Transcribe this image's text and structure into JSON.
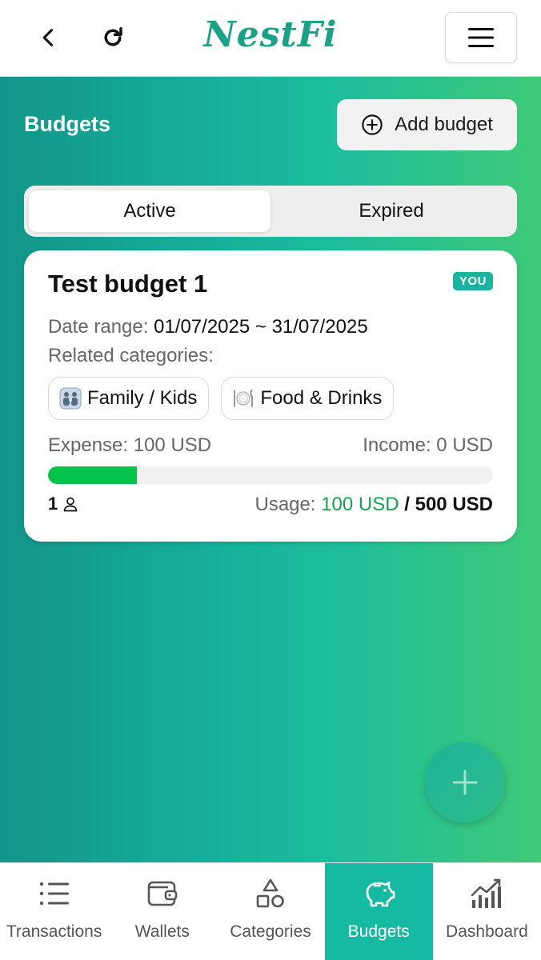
{
  "header": {
    "logo": "NestFi",
    "back_icon": "chevron-left-icon",
    "refresh_icon": "refresh-icon",
    "menu_icon": "hamburger-menu-icon"
  },
  "page": {
    "title": "Budgets",
    "add_button_label": "Add budget",
    "add_button_icon": "plus-circle-icon"
  },
  "tabs": [
    {
      "label": "Active",
      "active": true
    },
    {
      "label": "Expired",
      "active": false
    }
  ],
  "budget": {
    "title": "Test budget 1",
    "badge": "YOU",
    "date_range_label": "Date range:",
    "date_range_value": "01/07/2025 ~ 31/07/2025",
    "categories_label": "Related categories:",
    "categories": [
      {
        "label": "Family / Kids",
        "icon": "family-icon"
      },
      {
        "label": "Food & Drinks",
        "icon": "plate-cutlery-icon"
      }
    ],
    "expense_text": "Expense: 100 USD",
    "income_text": "Income: 0 USD",
    "usage_fraction": 0.2,
    "members_count": "1",
    "usage_label": "Usage:",
    "usage_used": "100 USD",
    "usage_separator": "/",
    "usage_total": "500 USD"
  },
  "bottom_nav": [
    {
      "label": "Transactions",
      "icon": "list-icon",
      "active": false
    },
    {
      "label": "Wallets",
      "icon": "wallet-icon",
      "active": false
    },
    {
      "label": "Categories",
      "icon": "shapes-icon",
      "active": false
    },
    {
      "label": "Budgets",
      "icon": "piggy-bank-icon",
      "active": true
    },
    {
      "label": "Dashboard",
      "icon": "bar-chart-icon",
      "active": false
    }
  ],
  "colors": {
    "brand": "#1aa287",
    "progress": "#05c24b",
    "active_nav": "#16b9a1"
  }
}
